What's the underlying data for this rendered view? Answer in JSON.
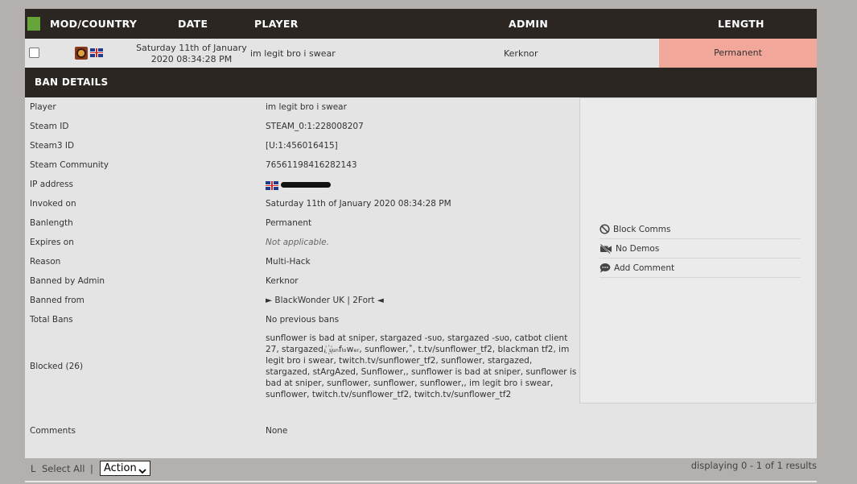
{
  "header": {
    "mod_country": "MOD/COUNTRY",
    "date": "DATE",
    "player": "PLAYER",
    "admin": "ADMIN",
    "length": "LENGTH",
    "colors": {
      "bar": "#2b2622",
      "square": "#66a338"
    }
  },
  "row": {
    "date_line1": "Saturday 11th of January",
    "date_line2": "2020 08:34:28 PM",
    "player": "im legit bro i swear",
    "admin": "Kerknor",
    "length": "Permanent",
    "length_color": "#f2a79b",
    "mod_icon": "tf2-icon",
    "flag_icon": "uk-flag-icon"
  },
  "details": {
    "title": "BAN DETAILS",
    "rows": [
      {
        "label": "Player",
        "value": "im legit bro i swear"
      },
      {
        "label": "Steam ID",
        "value": "STEAM_0:1:228008207"
      },
      {
        "label": "Steam3 ID",
        "value": "[U:1:456016415]"
      },
      {
        "label": "Steam Community",
        "value": "76561198416282143"
      },
      {
        "label": "IP address",
        "value": ""
      },
      {
        "label": "Invoked on",
        "value": "Saturday 11th of January 2020 08:34:28 PM"
      },
      {
        "label": "Banlength",
        "value": "Permanent"
      },
      {
        "label": "Expires on",
        "value": "Not applicable."
      },
      {
        "label": "Reason",
        "value": "Multi-Hack"
      },
      {
        "label": "Banned by Admin",
        "value": "Kerknor"
      },
      {
        "label": "Banned from",
        "value": "► BlackWonder UK | 2Fort ◄"
      },
      {
        "label": "Total Bans",
        "value": "No previous bans"
      },
      {
        "label": "Blocked (26)",
        "value": "sunflower is bad at sniper, stargazed -ꜱᴜᴏ, stargazed -ꜱᴜᴏ, catbot client 27, stargazed, ꙰ₛᵤₙfₗₒwₑᵣ, sunflower,˚, t.tv/sunflower_tf2, blackman tf2, im legit bro i swear, twitch.tv/sunflower_tf2, sunflower, stargazed, stargazed, stArgAzed, Sunflower,, sunflower is bad at sniper, sunflower is bad at sniper, sunflower, sunflower, sunflower,, im legit bro i swear, sunflower, twitch.tv/sunflower_tf2, twitch.tv/sunflower_tf2"
      },
      {
        "label": "Comments",
        "value": "None"
      }
    ]
  },
  "actions": [
    {
      "label": "Block Comms",
      "icon": "block-icon"
    },
    {
      "label": "No Demos",
      "icon": "no-video-icon"
    },
    {
      "label": "Add Comment",
      "icon": "comment-icon"
    }
  ],
  "footer": {
    "arrow": "L",
    "select_all": "Select All",
    "separator": "|",
    "action_select": "Action",
    "results": "displaying 0 - 1 of 1 results"
  }
}
